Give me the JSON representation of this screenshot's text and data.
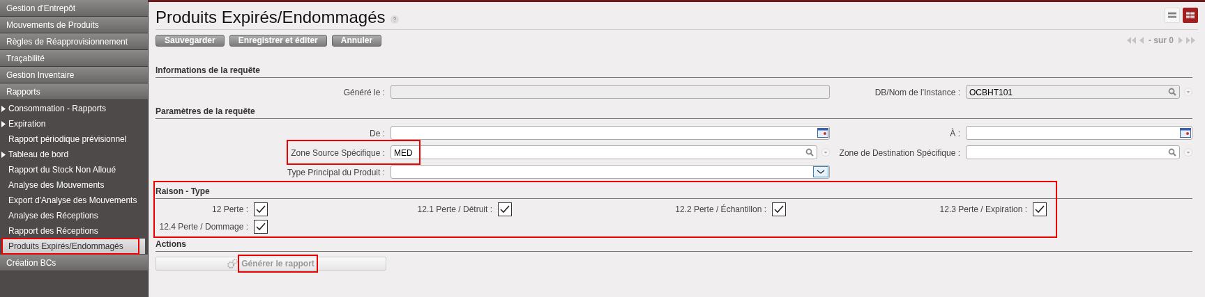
{
  "sidebar": {
    "items": [
      {
        "label": "Gestion d'Entrepôt"
      },
      {
        "label": "Mouvements de Produits"
      },
      {
        "label": "Règles de Réapprovisionnement"
      },
      {
        "label": "Traçabilité"
      },
      {
        "label": "Gestion Inventaire"
      },
      {
        "label": "Rapports",
        "children": [
          {
            "label": "Consommation - Rapports",
            "has_submenu": true,
            "selected": false,
            "highlighted": false
          },
          {
            "label": "Expiration",
            "has_submenu": true,
            "selected": false,
            "highlighted": false
          },
          {
            "label": "Rapport périodique prévisionnel",
            "has_submenu": false,
            "selected": false,
            "highlighted": false
          },
          {
            "label": "Tableau de bord",
            "has_submenu": true,
            "selected": false,
            "highlighted": false
          },
          {
            "label": "Rapport du Stock Non Alloué",
            "has_submenu": false,
            "selected": false,
            "highlighted": false
          },
          {
            "label": "Analyse des Mouvements",
            "has_submenu": false,
            "selected": false,
            "highlighted": false
          },
          {
            "label": "Export d'Analyse des Mouvements",
            "has_submenu": false,
            "selected": false,
            "highlighted": false
          },
          {
            "label": "Analyse des Réceptions",
            "has_submenu": false,
            "selected": false,
            "highlighted": false
          },
          {
            "label": "Rapport des Réceptions",
            "has_submenu": false,
            "selected": false,
            "highlighted": false
          },
          {
            "label": "Produits Expirés/Endommagés",
            "has_submenu": false,
            "selected": true,
            "highlighted": true
          }
        ]
      },
      {
        "label": "Création BCs"
      }
    ]
  },
  "page": {
    "title": "Produits Expirés/Endommagés",
    "view_toggles": [
      {
        "kind": "list",
        "selected": false
      },
      {
        "kind": "form",
        "selected": true
      }
    ],
    "toolbar": [
      "Sauvegarder",
      "Enregistrer et éditer",
      "Annuler"
    ],
    "pagination": "- sur 0"
  },
  "sections": [
    {
      "title": "Informations de la requête",
      "rows": [
        {
          "left": {
            "label": "Généré le :",
            "kind": "text",
            "readonly": true,
            "highlighted": false
          },
          "right": {
            "label": "DB/Nom de l'Instance :",
            "kind": "lookup",
            "value": "OCBHT101",
            "readonly": true,
            "highlighted": false
          }
        }
      ]
    },
    {
      "title": "Paramètres de la requête",
      "rows": [
        {
          "left": {
            "label": "De :",
            "kind": "date",
            "readonly": false,
            "highlighted": false
          },
          "right": {
            "label": "À :",
            "kind": "date",
            "readonly": false,
            "highlighted": false
          }
        },
        {
          "left": {
            "label": "Zone Source Spécifique :",
            "kind": "lookup",
            "value": "MED",
            "readonly": false,
            "highlighted": true
          },
          "right": {
            "label": "Zone de Destination Spécifique :",
            "kind": "lookup",
            "readonly": false,
            "highlighted": false
          }
        },
        {
          "left": {
            "label": "Type Principal du Produit :",
            "kind": "select",
            "readonly": false,
            "highlighted": false
          }
        }
      ]
    }
  ],
  "reasons": {
    "title": "Raison - Type",
    "highlighted": true,
    "items": [
      {
        "label": "12 Perte :",
        "checked": true
      },
      {
        "label": "12.1 Perte / Détruit :",
        "checked": true
      },
      {
        "label": "12.2 Perte / Échantillon :",
        "checked": true
      },
      {
        "label": "12.3 Perte / Expiration :",
        "checked": true
      },
      {
        "label": "12.4 Perte / Dommage :",
        "checked": true
      }
    ]
  },
  "actions": {
    "title": "Actions",
    "button": {
      "label": "Générer le rapport",
      "disabled": true,
      "highlighted": true
    }
  }
}
